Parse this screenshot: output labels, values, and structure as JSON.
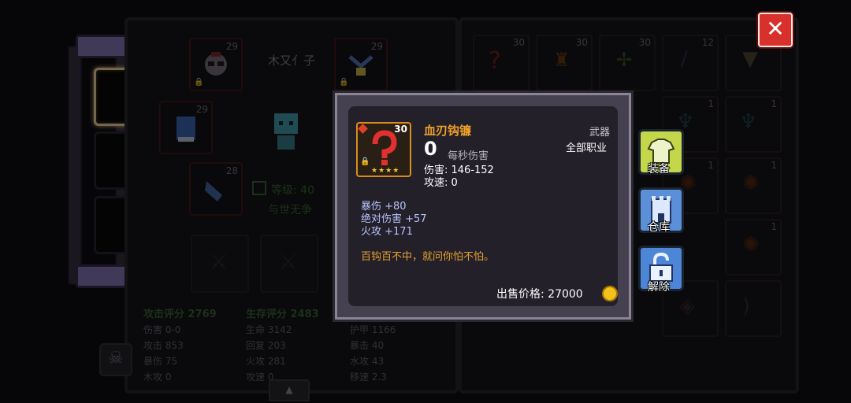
{
  "character": {
    "name": "木又亻子",
    "level_label": "等级: 40",
    "title": "与世无争"
  },
  "equipment_slots": [
    {
      "level": "29"
    },
    {
      "level": "29"
    },
    {
      "level": "29"
    },
    {
      "level": "28"
    }
  ],
  "stats": {
    "attack_score": "攻击评分 2769",
    "survival_score": "生存评分 2483",
    "col1": [
      "伤害 0-0",
      "攻击 853",
      "暴伤 75",
      "木攻 0"
    ],
    "col2": [
      "生命 3142",
      "回复 203",
      "火攻 281",
      "攻速 0"
    ],
    "col3": [
      "护甲 1166",
      "暴击 40",
      "水攻 43",
      "移速 2.3"
    ]
  },
  "inventory": {
    "row1_levels": [
      "30",
      "30",
      "30",
      "12",
      ""
    ],
    "other_levels": [
      "1",
      "1",
      "1",
      "1",
      "1"
    ]
  },
  "tooltip": {
    "item_name": "血刃钩镰",
    "item_level": "30",
    "item_type": "武器",
    "class_req": "全部职业",
    "dps_value": "0",
    "dps_label": "每秒伤害",
    "damage": "伤害: 146-152",
    "attack_speed": "攻速: 0",
    "stars": "★★★★",
    "bonuses": [
      "暴伤 +80",
      "绝对伤害 +57",
      "火攻 +171"
    ],
    "flavor": "百钩百不中，就问你怕不怕。",
    "sell_price": "出售价格: 27000"
  },
  "buttons": {
    "equip": "装备",
    "storage": "仓库",
    "unlock": "解除",
    "close": "✕"
  },
  "colors": {
    "item_name": "#f0a028",
    "flavor": "#e8a030",
    "bonus": "#b9c3ff",
    "equip_btn": "#c4d64a",
    "storage_btn": "#5b8fd8",
    "unlock_btn": "#4d86d6",
    "close_btn": "#d8302b"
  }
}
